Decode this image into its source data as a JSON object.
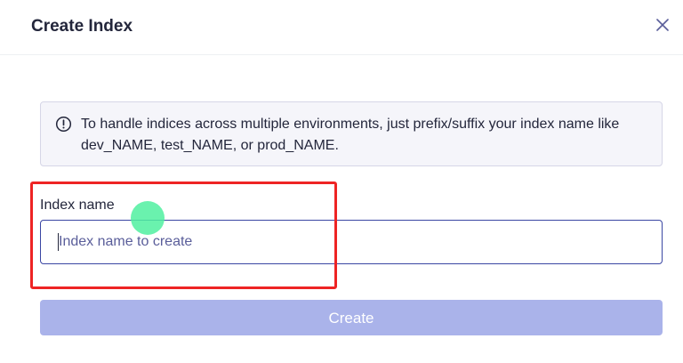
{
  "dialog": {
    "title": "Create Index",
    "close_icon": "close-icon"
  },
  "info": {
    "icon": "info-circle-icon",
    "text": "To handle indices across multiple environments, just prefix/suffix your index name like dev_NAME, test_NAME, or prod_NAME."
  },
  "form": {
    "index_name_label": "Index name",
    "index_name_value": "",
    "index_name_placeholder": "Index name to create"
  },
  "actions": {
    "create_label": "Create",
    "create_disabled": true
  },
  "colors": {
    "accent": "#3a46a3",
    "button_disabled": "#aab3ea",
    "highlight": "#ee2424",
    "info_bg": "#f5f5fa",
    "text": "#23263b"
  }
}
